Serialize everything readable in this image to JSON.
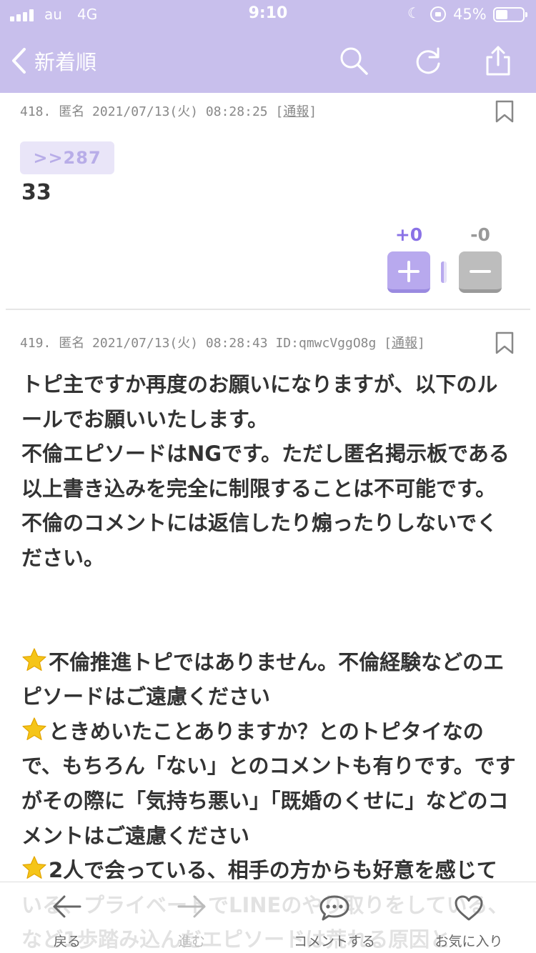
{
  "status_bar": {
    "carrier": "au",
    "network": "4G",
    "time": "9:10",
    "battery_percent_text": "45%",
    "battery_level": 0.45
  },
  "nav": {
    "back_label": "新着順",
    "icons": [
      "search-icon",
      "refresh-icon",
      "share-icon"
    ]
  },
  "comments": [
    {
      "number": "418.",
      "name": "匿名",
      "datetime": "2021/07/13(火) 08:28:25",
      "id": "",
      "report_label": "通報",
      "reply_anchor": ">>287",
      "body": "33",
      "votes": {
        "plus": "+0",
        "minus": "-0",
        "plus_ratio": 0.5
      }
    },
    {
      "number": "419.",
      "name": "匿名",
      "datetime": "2021/07/13(火) 08:28:43",
      "id": "ID:qmwcVggO8g",
      "report_label": "通報",
      "paragraphs": [
        "トピ主ですか再度のお願いになりますが、以下のルールでお願いいたします。",
        "不倫エピソードはNGです。ただし匿名掲示板である以上書き込みを完全に制限することは不可能です。不倫のコメントには返信したり煽ったりしないでください。",
        "不倫推進トピではありません。不倫経験などのエピソードはご遠慮ください",
        "ときめいたことありますか？とのトピタイなので、もちろん「ない」とのコメントも有りです。ですがその際に「気持ち悪い」「既婚のくせに」などのコメントはご遠慮ください",
        "2人で会っている、相手の方からも好意を感じている、プライベートでLINEのやり取りをしている、など1歩踏み込んだエピソードは荒れる原因と"
      ]
    }
  ],
  "tab_bar": [
    {
      "label": "戻る",
      "icon": "arrow-left-icon",
      "enabled": true
    },
    {
      "label": "進む",
      "icon": "arrow-right-icon",
      "enabled": false
    },
    {
      "label": "コメントする",
      "icon": "speech-bubble-icon",
      "enabled": true
    },
    {
      "label": "お気に入り",
      "icon": "heart-icon",
      "enabled": true
    }
  ],
  "colors": {
    "header": "#c8bfec",
    "accent": "#8a72e6",
    "plus_button": "#b8a9ee",
    "minus_button": "#bdbdbd",
    "star": "#f5c518"
  }
}
